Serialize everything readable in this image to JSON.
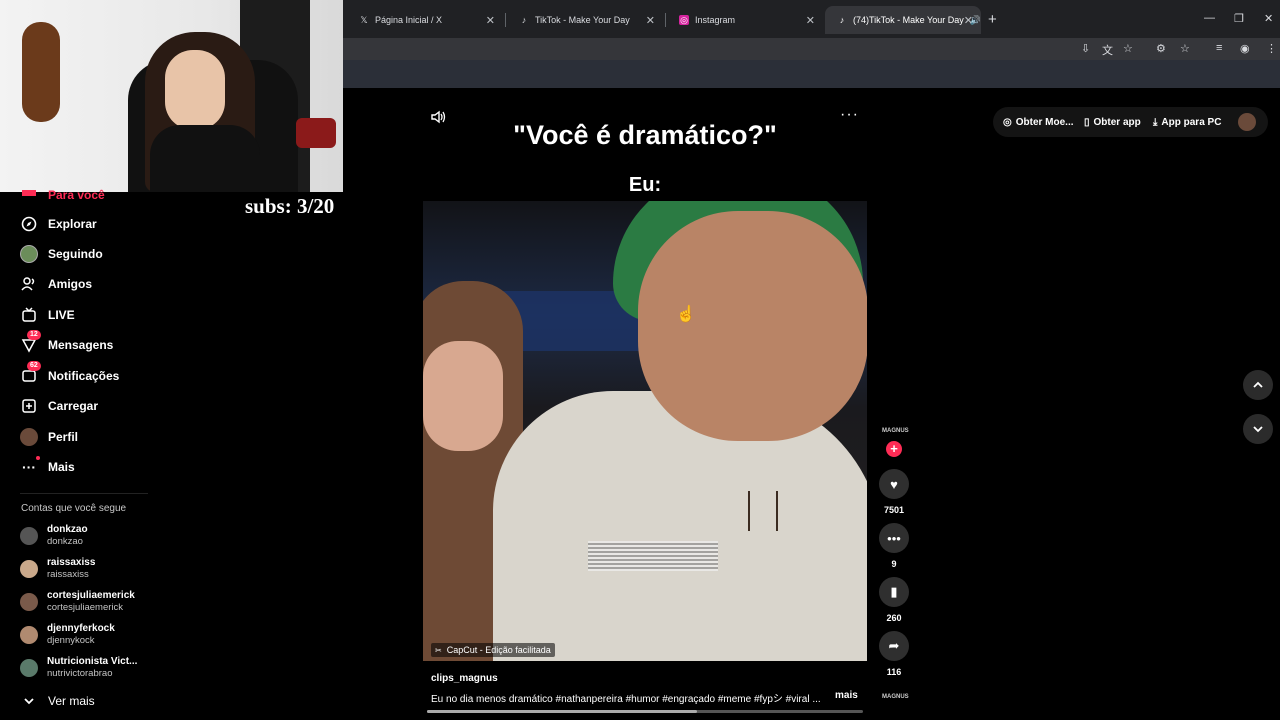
{
  "browser": {
    "tabs": [
      {
        "title": "Página Inicial / X",
        "icon": "x-logo-icon"
      },
      {
        "title": "TikTok - Make Your Day",
        "icon": "tiktok-icon"
      },
      {
        "title": "Instagram",
        "icon": "instagram-icon"
      },
      {
        "title": "(74)TikTok - Make Your Day",
        "icon": "tiktok-icon",
        "active": true
      }
    ]
  },
  "overlay": {
    "subs": "subs: 3/20"
  },
  "sidebar": {
    "partial_label": "Para você",
    "items": [
      {
        "label": "Explorar",
        "icon": "compass-icon"
      },
      {
        "label": "Seguindo",
        "icon": "following-avatar-icon"
      },
      {
        "label": "Amigos",
        "icon": "friends-icon"
      },
      {
        "label": "LIVE",
        "icon": "live-tv-icon"
      },
      {
        "label": "Mensagens",
        "icon": "messages-icon",
        "badge": "12"
      },
      {
        "label": "Notificações",
        "icon": "notifications-icon",
        "badge": "62"
      },
      {
        "label": "Carregar",
        "icon": "upload-icon"
      },
      {
        "label": "Perfil",
        "icon": "profile-avatar-icon"
      },
      {
        "label": "Mais",
        "icon": "more-dots-icon"
      }
    ],
    "following_title": "Contas que você segue",
    "following": [
      {
        "username": "donkzao",
        "name": "donkzao"
      },
      {
        "username": "raissaxiss",
        "name": "raissaxiss"
      },
      {
        "username": "cortesjuliaemerick",
        "name": "cortesjuliaemerick"
      },
      {
        "username": "djennyferkock",
        "name": "djennykock"
      },
      {
        "username": "Nutricionista Vict...",
        "name": "nutrivictorabrao"
      }
    ],
    "see_more": "Ver mais"
  },
  "video": {
    "caption_top": "\"Você é dramático?\"",
    "caption_sub": "Eu:",
    "capcut_label": "CapCut - Edição facilitada",
    "creator": "clips_magnus",
    "description": "Eu no dia menos dramático #nathanpereira  #humor  #engraçado  #meme  #fypシ  #viral  ...",
    "more_label": "mais",
    "progress": 0.62
  },
  "actions": {
    "avatar_text": "MAGNUS",
    "likes": "7501",
    "comments": "9",
    "saves": "260",
    "shares": "116"
  },
  "topright": {
    "coins": "Obter Moe...",
    "app": "Obter app",
    "pc": "App para PC"
  }
}
